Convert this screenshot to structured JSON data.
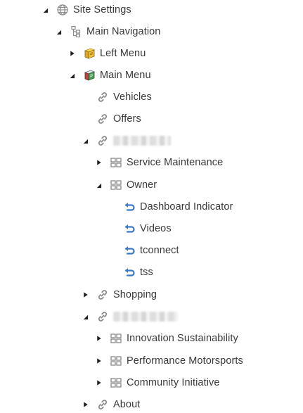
{
  "tree": {
    "site_settings": {
      "label": "Site Settings",
      "icon": "globe-icon"
    },
    "main_navigation": {
      "label": "Main Navigation",
      "icon": "hierarchy-icon"
    },
    "left_menu": {
      "label": "Left Menu",
      "icon": "menu-book-icon"
    },
    "main_menu": {
      "label": "Main Menu",
      "icon": "menu-book-icon"
    },
    "vehicles": {
      "label": "Vehicles",
      "icon": "link-icon"
    },
    "offers": {
      "label": "Offers",
      "icon": "link-icon"
    },
    "redacted_1": {
      "label": "",
      "icon": "link-icon"
    },
    "service_maintenance": {
      "label": "Service Maintenance",
      "icon": "grid-icon"
    },
    "owner": {
      "label": "Owner",
      "icon": "grid-icon"
    },
    "dashboard_indicator": {
      "label": "Dashboard Indicator",
      "icon": "refresh-link-icon"
    },
    "videos": {
      "label": "Videos",
      "icon": "refresh-link-icon"
    },
    "tconnect": {
      "label": "tconnect",
      "icon": "refresh-link-icon"
    },
    "tss": {
      "label": "tss",
      "icon": "refresh-link-icon"
    },
    "shopping": {
      "label": "Shopping",
      "icon": "link-icon"
    },
    "redacted_2": {
      "label": "",
      "icon": "link-icon"
    },
    "innovation_sustainability": {
      "label": "Innovation Sustainability",
      "icon": "grid-icon"
    },
    "performance_motorsports": {
      "label": "Performance Motorsports",
      "icon": "grid-icon"
    },
    "community_initiative": {
      "label": "Community Initiative",
      "icon": "grid-icon"
    },
    "about": {
      "label": "About",
      "icon": "link-icon"
    }
  },
  "colors": {
    "text": "#3a3a3a",
    "accent_blue": "#3b78c4",
    "toggle": "#1f1f1f"
  }
}
